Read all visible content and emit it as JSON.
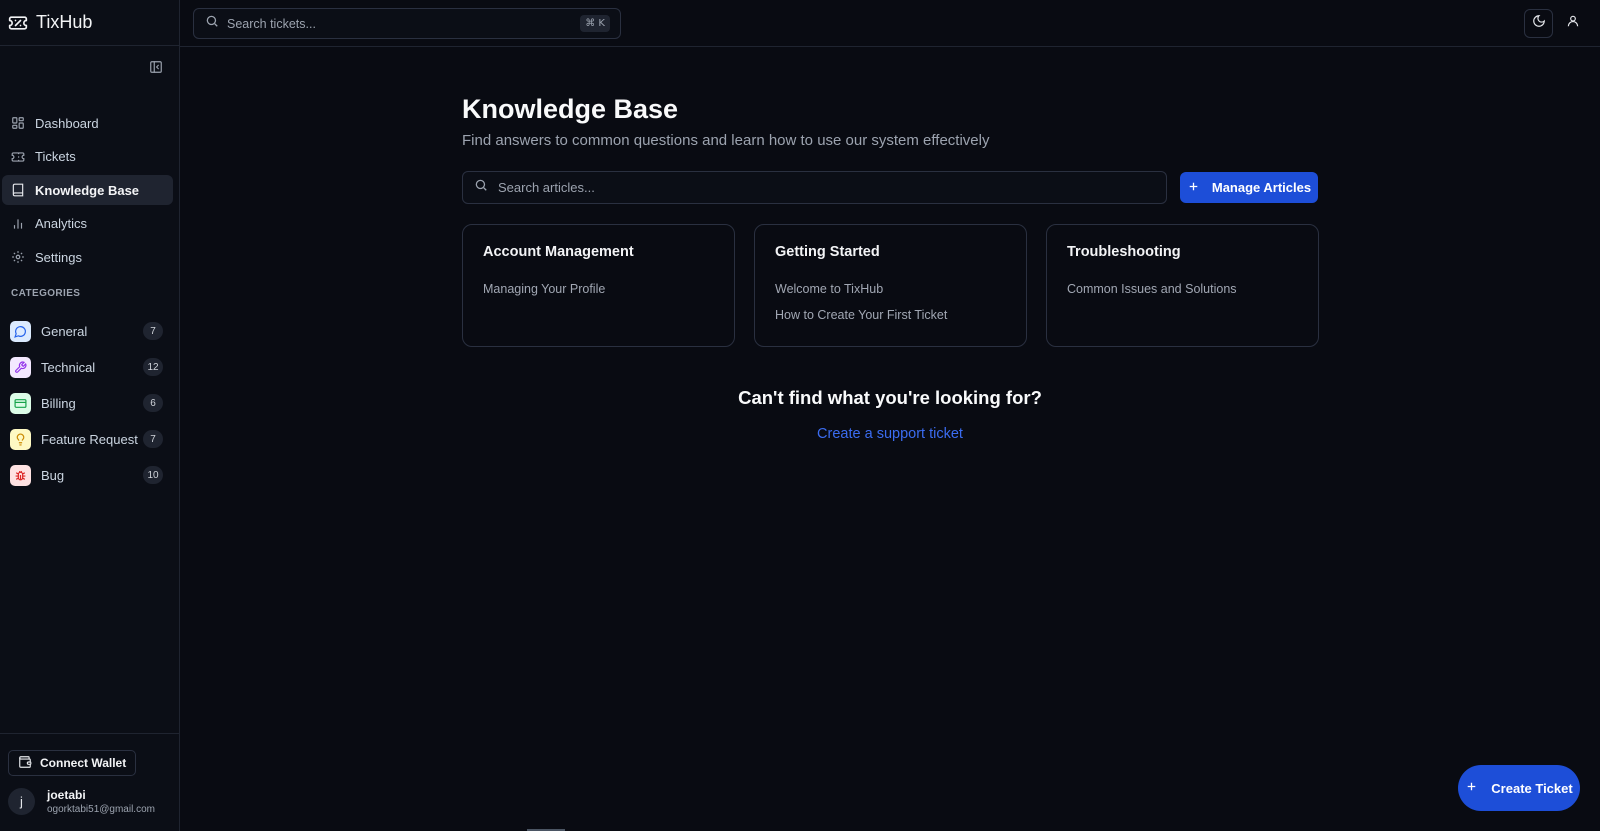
{
  "app": {
    "name": "TixHub"
  },
  "topbar": {
    "search_placeholder": "Search tickets...",
    "shortcut": "⌘ K",
    "icons": [
      "search-icon",
      "moon-icon",
      "user-icon"
    ]
  },
  "sidebar": {
    "nav": [
      {
        "label": "Dashboard",
        "icon": "grid-icon",
        "active": false
      },
      {
        "label": "Tickets",
        "icon": "ticket-icon",
        "active": false
      },
      {
        "label": "Knowledge Base",
        "icon": "book-icon",
        "active": true
      },
      {
        "label": "Analytics",
        "icon": "bar-chart-icon",
        "active": false
      },
      {
        "label": "Settings",
        "icon": "gear-icon",
        "active": false
      }
    ],
    "categories_heading": "CATEGORIES",
    "categories": [
      {
        "label": "General",
        "count": "7",
        "icon": "message-circle-icon",
        "color": "#3b82f6"
      },
      {
        "label": "Technical",
        "count": "12",
        "icon": "wrench-icon",
        "color": "#a855f7"
      },
      {
        "label": "Billing",
        "count": "6",
        "icon": "credit-card-icon",
        "color": "#22c55e"
      },
      {
        "label": "Feature Request",
        "count": "7",
        "icon": "lightbulb-icon",
        "color": "#eab308"
      },
      {
        "label": "Bug",
        "count": "10",
        "icon": "bug-icon",
        "color": "#ef4444"
      }
    ],
    "wallet_label": "Connect Wallet",
    "user": {
      "initial": "j",
      "name": "joetabi",
      "email": "ogorktabi51@gmail.com"
    }
  },
  "main": {
    "title": "Knowledge Base",
    "subtitle": "Find answers to common questions and learn how to use our system effectively",
    "search_placeholder": "Search articles...",
    "manage_label": "Manage Articles",
    "cards": [
      {
        "title": "Account Management",
        "links": [
          "Managing Your Profile"
        ]
      },
      {
        "title": "Getting Started",
        "links": [
          "Welcome to TixHub",
          "How to Create Your First Ticket"
        ]
      },
      {
        "title": "Troubleshooting",
        "links": [
          "Common Issues and Solutions"
        ]
      }
    ],
    "cta_title": "Can't find what you're looking for?",
    "cta_link": "Create a support ticket"
  },
  "fab_label": "Create Ticket",
  "colors": {
    "accent": "#1d4ed8",
    "link": "#3b6cf0",
    "background": "#090b12"
  }
}
